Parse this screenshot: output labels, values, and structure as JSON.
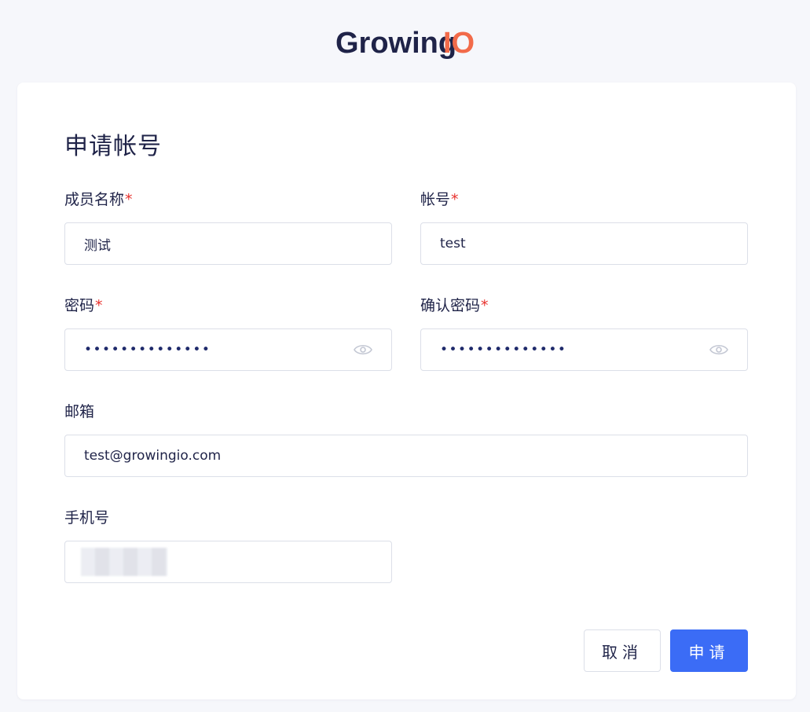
{
  "brand": {
    "name_part1": "Growing",
    "name_part2": "IO",
    "color_primary": "#1f2348",
    "color_accent": "#f26b4a"
  },
  "form": {
    "title": "申请帐号",
    "member_name": {
      "label": "成员名称",
      "required": "*",
      "value": "测试"
    },
    "account": {
      "label": "帐号",
      "required": "*",
      "value": "test"
    },
    "password": {
      "label": "密码",
      "required": "*",
      "value": "••••••••••••••",
      "icon": "eye-icon"
    },
    "confirm_password": {
      "label": "确认密码",
      "required": "*",
      "value": "••••••••••••••",
      "icon": "eye-icon"
    },
    "email": {
      "label": "邮箱",
      "value": "test@growingio.com"
    },
    "phone": {
      "label": "手机号",
      "value": ""
    }
  },
  "actions": {
    "cancel_label": "取消",
    "submit_label": "申请",
    "submit_color": "#3b6cf6"
  }
}
